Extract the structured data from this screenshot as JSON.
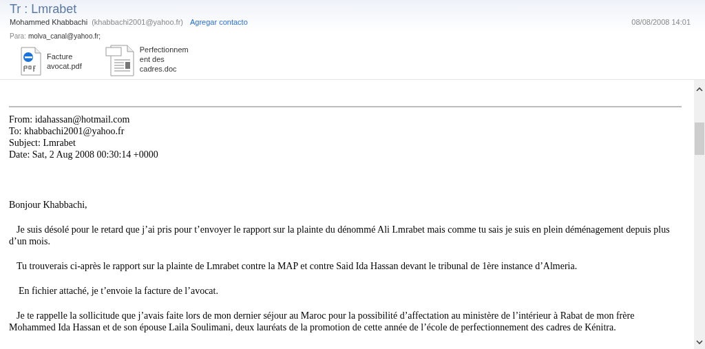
{
  "message": {
    "title": "Tr : Lmrabet",
    "sender_name": "Mohammed Khabbachi",
    "sender_email": "(khabbachi2001@yahoo.fr)",
    "add_contact": "Agregar contacto",
    "date": "08/08/2008 14:01",
    "to_label": "Para:",
    "to": "molva_canal@yahoo.fr;"
  },
  "attachments": [
    {
      "kind": "pdf",
      "lines": [
        "Facture",
        "avocat.pdf"
      ]
    },
    {
      "kind": "doc",
      "lines": [
        "Perfectionnem",
        "ent des",
        "cadres.doc"
      ]
    }
  ],
  "forwarded_headers": [
    "From: idahassan@hotmail.com",
    "To: khabbachi2001@yahoo.fr",
    "Subject: Lmrabet",
    "Date: Sat, 2 Aug 2008 00:30:14 +0000"
  ],
  "greeting": "Bonjour Khabbachi,",
  "paragraphs": [
    "Je suis désolé pour le retard que j’ai pris pour t’envoyer le rapport sur la plainte du dénommé Ali Lmrabet mais comme tu sais je suis en plein déménagement depuis plus d’un mois.",
    "Tu trouverais ci-après le rapport sur la plainte de Lmrabet contre la MAP et contre Said Ida Hassan devant le tribunal de 1ère instance d’Almeria.",
    "En fichier attaché, je t’envoie la facture de l’avocat.",
    "Je te rappelle la sollicitude que j’avais faite lors de mon dernier séjour au Maroc pour la possibilité d’affectation au ministère de l’intérieur à Rabat de mon frère Mohammed Ida Hassan et de son épouse Laila Soulimani, deux lauréats de la promotion de cette année de l’école de perfectionnement des cadres de Kénitra."
  ]
}
